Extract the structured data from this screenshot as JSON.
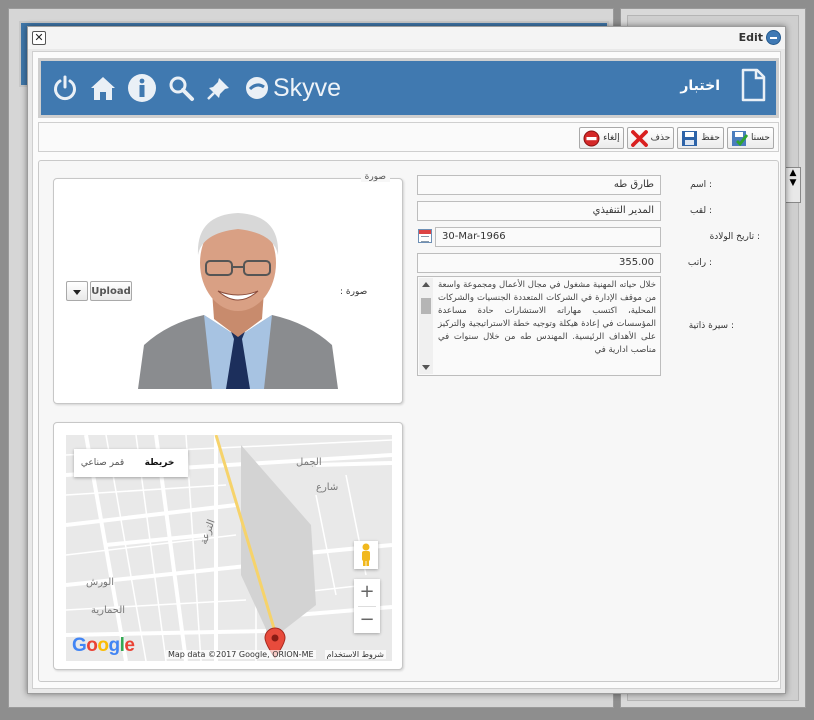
{
  "dialog": {
    "title": "Edit"
  },
  "header": {
    "brand": "Skyve",
    "title": "اختبار",
    "icons": [
      "power-icon",
      "home-icon",
      "info-icon",
      "search-icon",
      "pin-icon",
      "skyve-logo-icon",
      "document-icon"
    ]
  },
  "toolbar": {
    "ok_label": "حسنا",
    "save_label": "حفظ",
    "delete_label": "حذف",
    "cancel_label": "إلغاء"
  },
  "form": {
    "name_label": "اسم :",
    "name_value": "طارق طه",
    "title_label": "لقب :",
    "title_value": "المدير التنفيذي",
    "dob_label": "تاريخ الولادة :",
    "dob_value": "30-Mar-1966",
    "salary_label": "راتب :",
    "salary_value": "355.00",
    "bio_label": "سيرة ذاتية :",
    "bio_text": "خلال حياته المهنية مشغول في مجال الأعمال ومجموعة واسعة من موقف الإدارة في الشركات المتعددة الجنسيات والشركات المحلية، اكتسب مهاراته الاستشارات حادة مساعدة المؤسسات في إعادة هيكلة وتوجيه خطة الاستراتيجية والتركيز على الأهداف الرئيسية. المهندس طه من خلال سنوات في مناصب ادارية في"
  },
  "photo": {
    "legend": "صورة",
    "label": "صورة :",
    "upload_label": "Upload"
  },
  "map": {
    "type_map": "خريطة",
    "type_satellite": "قمر صناعي",
    "attribution": "Map data ©2017 Google, ORION-ME",
    "terms": "شروط الاستخدام",
    "google": "Google",
    "zoom_in": "+",
    "zoom_out": "−"
  },
  "colors": {
    "header_bg": "#4079b0",
    "accent": "#3f79b4"
  }
}
